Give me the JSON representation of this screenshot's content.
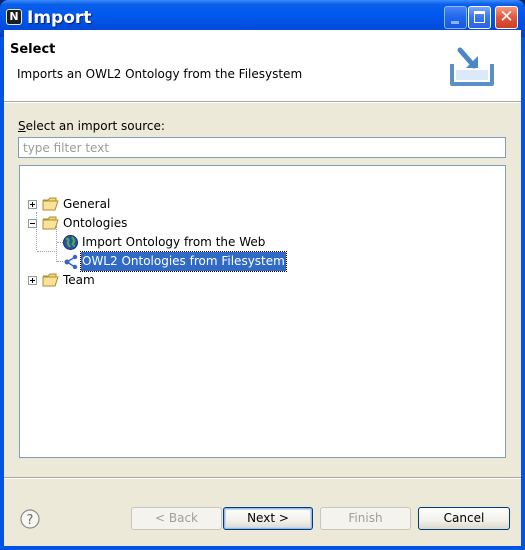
{
  "window": {
    "title": "Import",
    "app_icon_letter": "N"
  },
  "header": {
    "title": "Select",
    "description": "Imports an OWL2 Ontology from the Filesystem",
    "icon": "import-wizard-icon"
  },
  "source": {
    "label_prefix": "S",
    "label_rest": "elect an import source:",
    "filter_placeholder": "type filter text",
    "filter_value": ""
  },
  "tree": {
    "items": [
      {
        "label": "General",
        "expanded": false,
        "icon": "folder-icon"
      },
      {
        "label": "Ontologies",
        "expanded": true,
        "icon": "folder-icon"
      },
      {
        "label": "Import Ontology from the Web",
        "icon": "globe-icon",
        "parent": "Ontologies"
      },
      {
        "label": "OWL2 Ontologies from Filesystem",
        "icon": "ontology-graph-icon",
        "parent": "Ontologies",
        "selected": true
      },
      {
        "label": "Team",
        "expanded": false,
        "icon": "folder-icon"
      }
    ]
  },
  "buttons": {
    "back": "< Back",
    "next": "Next >",
    "finish": "Finish",
    "cancel": "Cancel",
    "help_icon": "help-icon"
  },
  "colors": {
    "titlebar": "#0058ee",
    "selection": "#316ac5",
    "dialog_bg": "#ece9d8"
  }
}
